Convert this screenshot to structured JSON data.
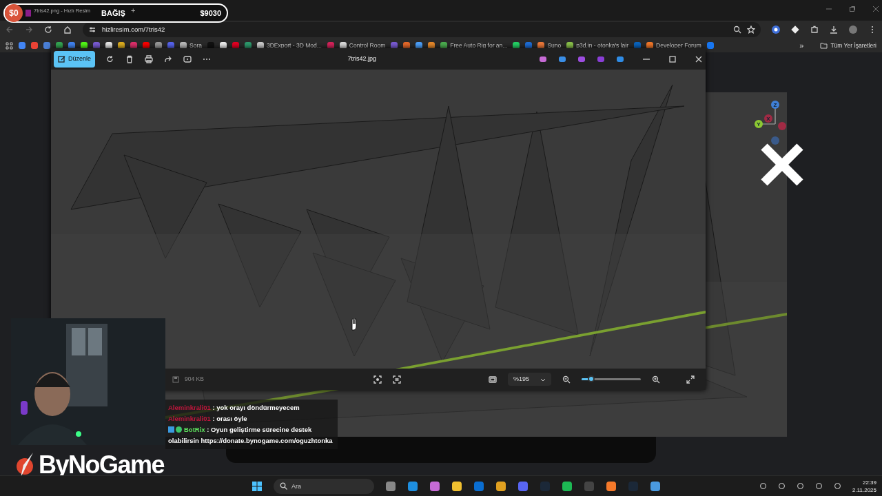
{
  "donation_bar": {
    "amount": "$0",
    "label": "BAĞIŞ",
    "plus": "+",
    "goal": "$9030"
  },
  "browser": {
    "tab_title": "7tris42.png - Hızlı Resim",
    "url": "hizliresim.com/7tris42",
    "bookmarks": [
      {
        "color": "#4285f4"
      },
      {
        "color": "#ea4335"
      },
      {
        "color": "#4a7fd6"
      },
      {
        "color": "#34a853"
      },
      {
        "color": "#4285f4"
      },
      {
        "color": "#53fc18"
      },
      {
        "color": "#7b5cd6"
      },
      {
        "color": "#e8e8e8"
      },
      {
        "color": "#e0b020"
      },
      {
        "color": "#e1306c"
      },
      {
        "color": "#ff0000"
      },
      {
        "color": "#9a9a9a"
      },
      {
        "color": "#5865f2"
      },
      {
        "color": "#bbbbbb",
        "label": "Sora"
      },
      {
        "color": "#111111"
      },
      {
        "color": "#f0f0f0"
      },
      {
        "color": "#e60023"
      },
      {
        "color": "#2e9c6e"
      },
      {
        "color": "#cccccc",
        "label": "3DExport - 3D Mod..."
      },
      {
        "color": "#d8235c"
      },
      {
        "color": "#dddddd",
        "label": "Control Room"
      },
      {
        "color": "#7b5cd6"
      },
      {
        "color": "#e86a2b"
      },
      {
        "color": "#4da3ff"
      },
      {
        "color": "#e88a2b"
      },
      {
        "color": "#4caf50",
        "label": "Free Auto Rig for an..."
      },
      {
        "color": "#25d366"
      },
      {
        "color": "#1e6fd9"
      },
      {
        "color": "#f07a3a",
        "label": "Suno"
      },
      {
        "color": "#8bc34a",
        "label": "p3d.in - otonka's lair"
      },
      {
        "color": "#0a66c2"
      },
      {
        "color": "#f5792a",
        "label": "Developer Forum"
      },
      {
        "color": "#1877f2"
      }
    ],
    "more": "»",
    "all_bookmarks": "Tüm Yer İşaretleri"
  },
  "viewer": {
    "edit_button": "Düzenle",
    "file_name": "7tris42.jpg",
    "file_size": "904 KB",
    "zoom": "%195",
    "level": 0.16
  },
  "gizmo": {
    "z": "Z",
    "x": "X",
    "y": "Y"
  },
  "chat": [
    {
      "kind": "user",
      "user": "Aleminkrali01",
      "message": ": yok orayı döndürmeyecem"
    },
    {
      "kind": "user",
      "user": "Aleminkrali01",
      "message": ": orası öyle"
    },
    {
      "kind": "bot",
      "user": "BotRix",
      "message": ": Oyun geliştirme sürecine destek olabilirsin https://donate.bynogame.com/oguzhtonka"
    }
  ],
  "logo": "ByNoGame",
  "taskbar": {
    "search_placeholder": "Ara",
    "time": "22:39",
    "date": "2.11.2025"
  }
}
